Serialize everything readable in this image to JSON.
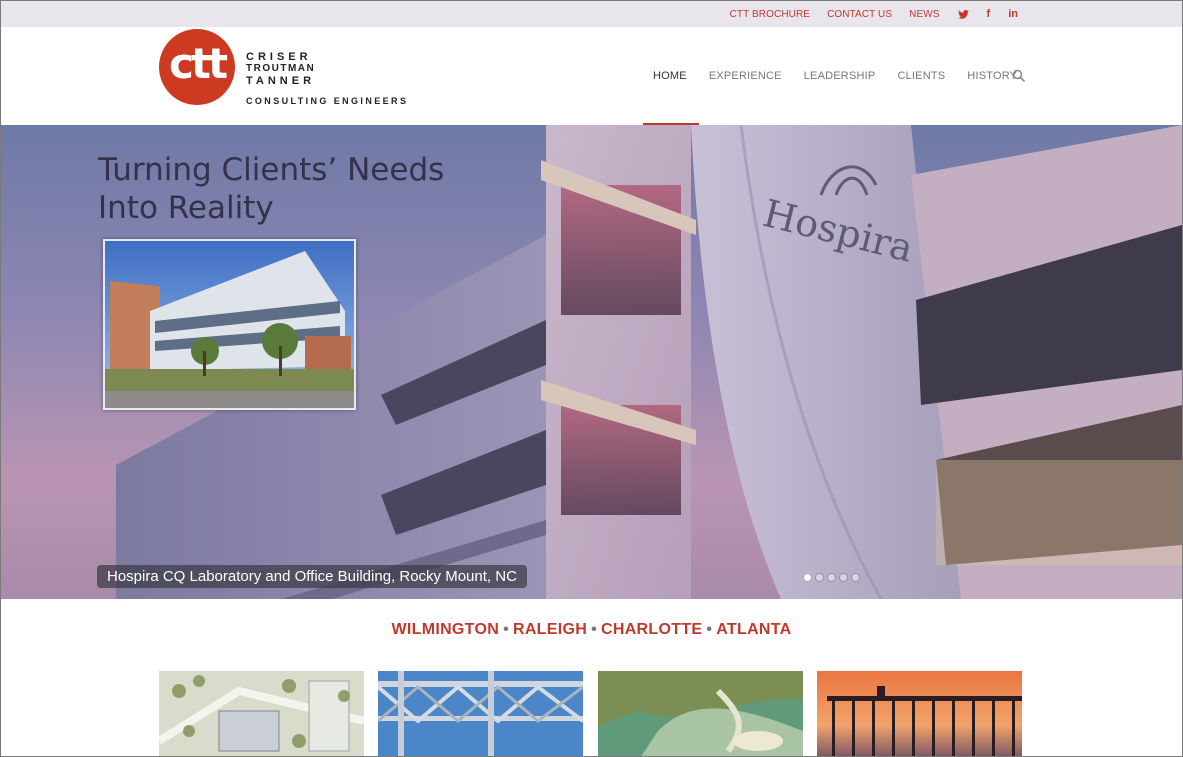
{
  "topbar": {
    "links": [
      "CTT BROCHURE",
      "CONTACT US",
      "NEWS"
    ],
    "social": [
      {
        "name": "twitter-icon",
        "glyph": "✦"
      },
      {
        "name": "facebook-icon",
        "glyph": "f"
      },
      {
        "name": "linkedin-icon",
        "glyph": "in"
      }
    ]
  },
  "logo": {
    "mark": "ctt",
    "line1": "CRISER",
    "line2": "TROUTMAN",
    "line3": "TANNER",
    "subtitle": "CONSULTING ENGINEERS"
  },
  "nav": {
    "items": [
      "HOME",
      "EXPERIENCE",
      "LEADERSHIP",
      "CLIENTS",
      "HISTORY"
    ],
    "active": "HOME"
  },
  "hero": {
    "title_line1": "Turning Clients’ Needs",
    "title_line2": "Into Reality",
    "building_sign": "Hospira",
    "caption": "Hospira CQ Laboratory and Office Building, Rocky Mount, NC",
    "slide_count": 5,
    "active_slide": 1
  },
  "locations": [
    "WILMINGTON",
    "RALEIGH",
    "CHARLOTTE",
    "ATLANTA"
  ],
  "colors": {
    "brand_red": "#c0392b",
    "logo_red": "#cc3a22",
    "topbar_bg": "#e8e6ec"
  }
}
